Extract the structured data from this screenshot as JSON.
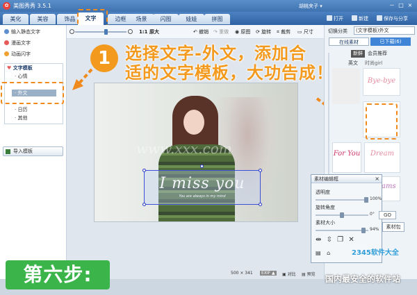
{
  "window": {
    "title": "美图秀秀 3.5.1",
    "user": "胡桃夹子 ▾",
    "controls": [
      "－",
      "□",
      "×"
    ]
  },
  "menu": {
    "tabs": [
      "美化",
      "美容",
      "饰品",
      "文字",
      "边框",
      "场景",
      "闪图",
      "娃娃",
      "拼图"
    ],
    "active_tab": "文字",
    "open": "打开",
    "new": "新建",
    "save": "保存与分享"
  },
  "left_panel": {
    "items": [
      {
        "label": "输入静态文字",
        "color": "#5b8fd0"
      },
      {
        "label": "漫画文字",
        "color": "#e65a5a"
      },
      {
        "label": "动画闪字",
        "color": "#f0a030"
      }
    ],
    "tree_root": "文字模板",
    "tree_children": [
      "心情",
      "外文",
      "日历",
      "其他"
    ],
    "selected_child": "外文",
    "import_button": "导入模板"
  },
  "toolbar": {
    "zoom_label": "1:1 原大",
    "zoom_level": 0.6,
    "buttons": [
      {
        "label": "撤销",
        "enabled": true
      },
      {
        "label": "重做",
        "enabled": false
      },
      {
        "label": "原图",
        "enabled": true
      },
      {
        "label": "旋转",
        "enabled": true
      },
      {
        "label": "裁剪",
        "enabled": true
      },
      {
        "label": "尺寸",
        "enabled": true
      }
    ]
  },
  "callout": {
    "number": "1",
    "line1": "选择文字-外文，添加合",
    "line2": "适的文字模板，大功告成！"
  },
  "photo": {
    "watermark": "www.xxx.com",
    "text_main": "I miss you",
    "text_sub": "You are always in my mind"
  },
  "right_panel": {
    "category_label": "切换分类",
    "category_value": "(文字模板)外文",
    "tabs": [
      "在线素材",
      "已下载(6)"
    ],
    "subtabs": [
      "新鲜",
      "会员推荐",
      "英文",
      "时尚girl"
    ],
    "thumbnails": [
      "Bye-bye",
      "",
      "For You",
      "Dream",
      "Dreams"
    ]
  },
  "editor": {
    "title": "素材编辑框",
    "close": "×",
    "transparency_label": "透明度",
    "transparency_value": "100%",
    "transparency": 1.0,
    "rotation_label": "旋转角度",
    "rotation_value": "0°",
    "rotation": 0.5,
    "size_label": "素材大小",
    "size_value": "94%",
    "size": 0.94,
    "go": "GO",
    "wall": "素材包"
  },
  "status": {
    "dimensions": "500 × 341",
    "exif": "EXIF ▲",
    "compare": "对比",
    "preview": "预览"
  },
  "step": {
    "label": "第六步:"
  },
  "brand": {
    "tag": "国内最安全的软件站",
    "logo": "2345软件大全"
  }
}
